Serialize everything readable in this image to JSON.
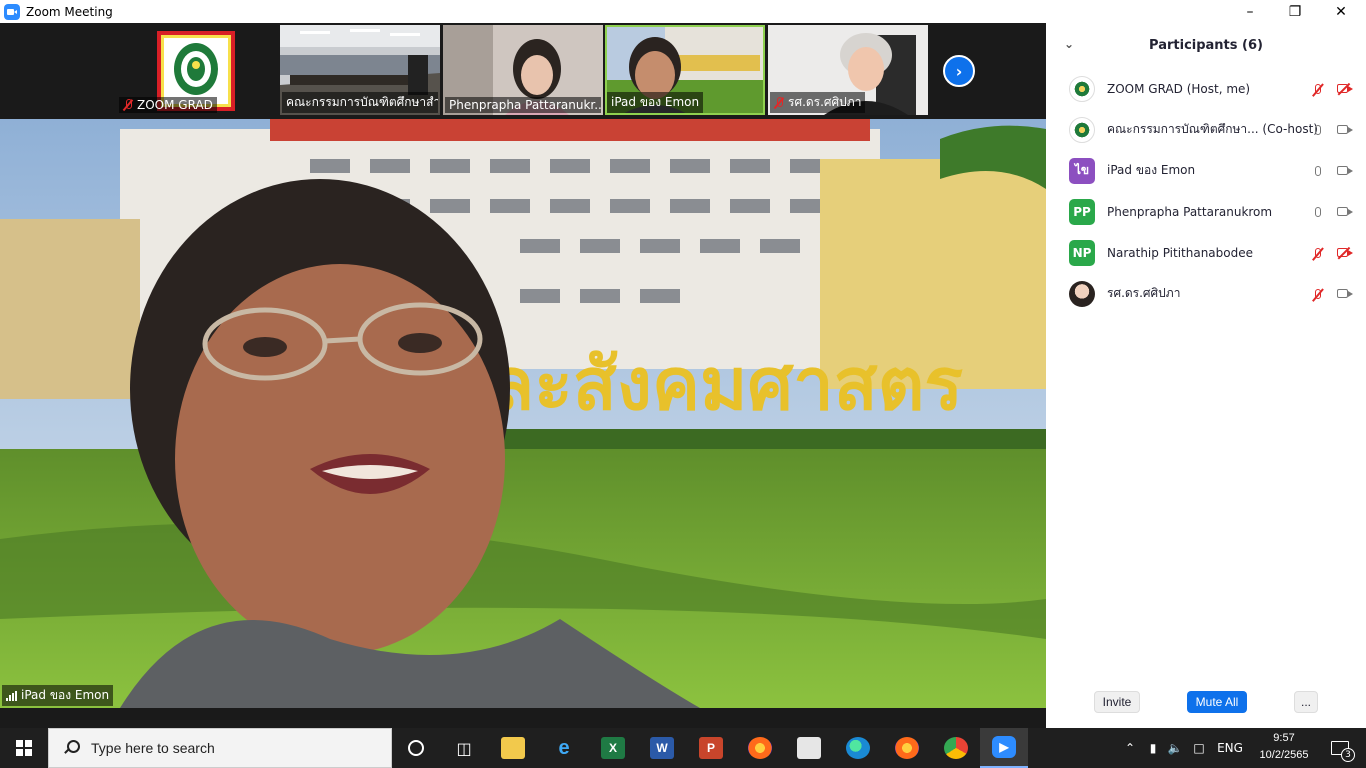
{
  "window": {
    "title": "Zoom Meeting",
    "icon": "zoom-app-icon",
    "controls": [
      "minimize-icon",
      "restore-icon",
      "close-icon"
    ]
  },
  "gallery": {
    "thumbnails": [
      {
        "label": "ZOOM GRAD",
        "muted": true
      },
      {
        "label": "คณะกรรมการบัณฑิตศึกษาสำ...",
        "muted": false
      },
      {
        "label": "Phenprapha Pattaranukr...",
        "muted": false
      },
      {
        "label": "iPad ของ Emon",
        "muted": false,
        "active": true
      },
      {
        "label": "รศ.ดร.ศศิปภา",
        "muted": true
      }
    ],
    "next_icon": "chevron-right-icon"
  },
  "main_video": {
    "label": "iPad ของ Emon",
    "sign_text": "ละสังคมศาสตร"
  },
  "participants": {
    "title": "Participants (6)",
    "list": [
      {
        "name": "ZOOM GRAD (Host, me)",
        "avatar": "logo",
        "initials": "",
        "mic": "off",
        "cam": "off"
      },
      {
        "name": "คณะกรรมการบัณฑิตศึกษา... (Co-host)",
        "avatar": "logo",
        "initials": "",
        "mic": "on",
        "cam": "on"
      },
      {
        "name": "iPad ของ Emon",
        "avatar": "initials",
        "initials": "ไข",
        "color": "#8c4fc0",
        "mic": "on",
        "cam": "on"
      },
      {
        "name": "Phenprapha Pattaranukrom",
        "avatar": "initials",
        "initials": "PP",
        "color": "#2aa84a",
        "mic": "on",
        "cam": "on"
      },
      {
        "name": "Narathip Pitithanabodee",
        "avatar": "initials",
        "initials": "NP",
        "color": "#2aa84a",
        "mic": "off",
        "cam": "off"
      },
      {
        "name": "รศ.ดร.ศศิปภา",
        "avatar": "photo",
        "initials": "",
        "mic": "off",
        "cam": "on"
      }
    ],
    "invite_label": "Invite",
    "mute_all_label": "Mute All",
    "more_label": "..."
  },
  "taskbar": {
    "search_placeholder": "Type here to search",
    "apps": [
      "task-view-icon",
      "file-explorer-icon",
      "internet-explorer-icon",
      "excel-icon",
      "word-icon",
      "powerpoint-icon",
      "firefox-icon",
      "store-icon",
      "edge-icon",
      "firefox-icon",
      "chrome-icon",
      "zoom-icon"
    ],
    "language": "ENG",
    "time": "9:57",
    "date": "10/2/2565",
    "notifications": "3"
  },
  "colors": {
    "accent": "#0e71eb",
    "muted_red": "#e02828",
    "active_thumb": "#8fd14f"
  }
}
